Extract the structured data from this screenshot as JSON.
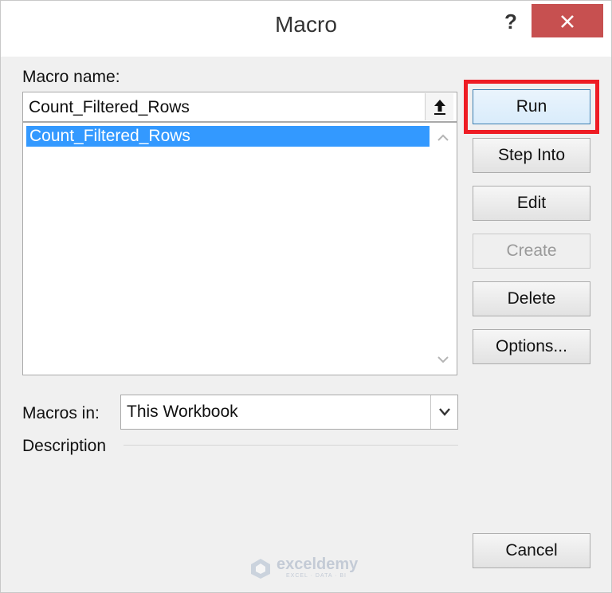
{
  "window": {
    "title": "Macro",
    "help_label": "?"
  },
  "macro_name": {
    "label": "Macro name:",
    "value": "Count_Filtered_Rows"
  },
  "macro_list": {
    "items": [
      "Count_Filtered_Rows"
    ],
    "selected_index": 0
  },
  "buttons": {
    "run": "Run",
    "step_into": "Step Into",
    "edit": "Edit",
    "create": "Create",
    "delete": "Delete",
    "options": "Options...",
    "cancel": "Cancel"
  },
  "macros_in": {
    "label": "Macros in:",
    "value": "This Workbook"
  },
  "description": {
    "label": "Description"
  },
  "watermark": {
    "brand": "exceldemy",
    "tagline": "EXCEL · DATA · BI"
  },
  "colors": {
    "close_bg": "#c75050",
    "selection": "#3399ff",
    "highlight": "#ee1c24"
  },
  "icons": {
    "close": "close-icon",
    "upload": "upload-arrow-icon",
    "scroll_up": "chevron-up-icon",
    "scroll_down": "chevron-down-icon",
    "dropdown": "chevron-down-icon"
  }
}
